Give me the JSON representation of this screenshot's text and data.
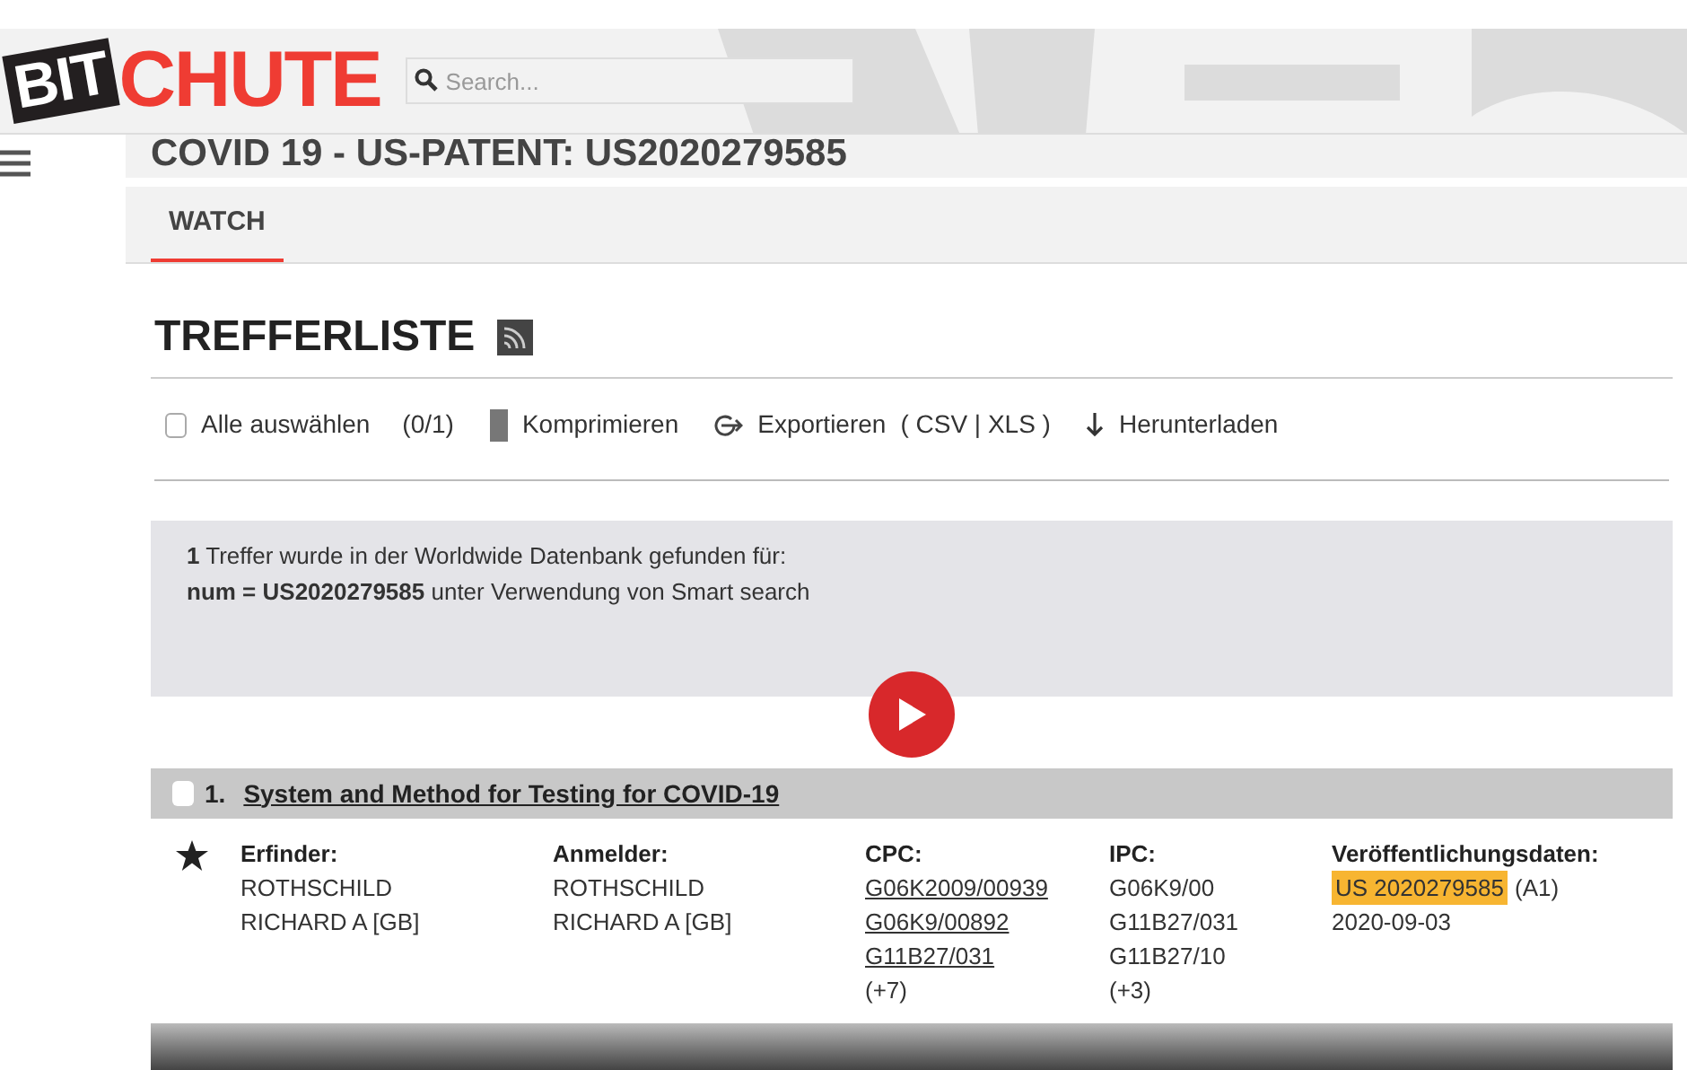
{
  "header": {
    "logo_left": "BIT",
    "logo_right": "CHUTE",
    "search": {
      "placeholder": "Search..."
    }
  },
  "video_title": "COVID 19 - US-PATENT: US2020279585",
  "tabs": [
    {
      "label": "WATCH",
      "selected": true
    }
  ],
  "video": {
    "heading": "TREFFERLISTE",
    "toolbar": [
      {
        "kind": "checkbox",
        "label": "Alle auswählen",
        "count": "(0/1)",
        "checked": false
      },
      {
        "kind": "compress",
        "label": "Komprimieren"
      },
      {
        "kind": "export",
        "label": "Exportieren",
        "extra": "( CSV | XLS )"
      },
      {
        "kind": "download",
        "label": "Herunterladen"
      }
    ],
    "info_lines": [
      "**1** Treffer wurde in der Worldwide Datenbank gefunden für:",
      "**num = US2020279585** unter Verwendung von Smart search"
    ],
    "result": {
      "number": "1.",
      "title": "System and Method for Testing for COVID-19",
      "checked": false,
      "columns": [
        {
          "heading": "Erfinder:",
          "lines": [
            {
              "text": "ROTHSCHILD",
              "kind": "plain"
            },
            {
              "text": "RICHARD A  [GB]",
              "kind": "plain"
            }
          ]
        },
        {
          "heading": "Anmelder:",
          "lines": [
            {
              "text": "ROTHSCHILD",
              "kind": "plain"
            },
            {
              "text": "RICHARD A  [GB]",
              "kind": "plain"
            }
          ]
        },
        {
          "heading": "CPC:",
          "lines": [
            {
              "text": "G06K2009/00939",
              "kind": "link"
            },
            {
              "text": "G06K9/00892",
              "kind": "link"
            },
            {
              "text": "G11B27/031",
              "kind": "link"
            },
            {
              "text": "(+7)",
              "kind": "plain"
            }
          ]
        },
        {
          "heading": "IPC:",
          "lines": [
            {
              "text": "G06K9/00",
              "kind": "plain"
            },
            {
              "text": "G11B27/031",
              "kind": "plain"
            },
            {
              "text": "G11B27/10",
              "kind": "plain"
            },
            {
              "text": "(+3)",
              "kind": "plain"
            }
          ]
        },
        {
          "heading": "Veröffentlichungsdaten:",
          "lines": [
            {
              "text": "US 2020279585",
              "kind": "highlight",
              "suffix": "(A1)"
            },
            {
              "text": "2020-09-03",
              "kind": "plain"
            }
          ]
        }
      ]
    }
  }
}
